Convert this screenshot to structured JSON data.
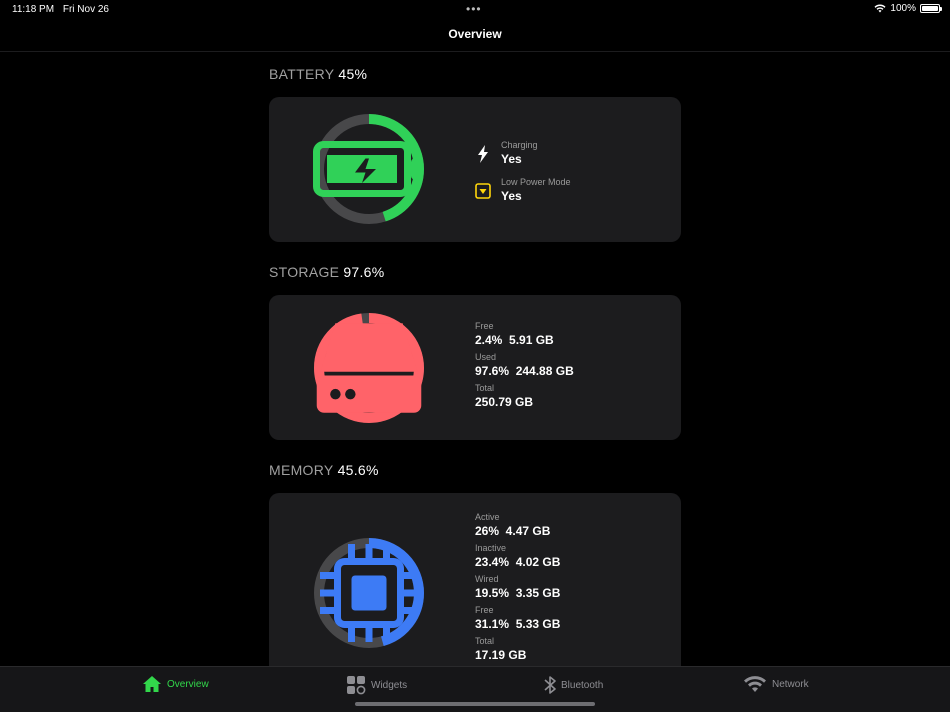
{
  "status": {
    "time": "11:18 PM",
    "date": "Fri Nov 26",
    "battery_text": "100%"
  },
  "nav": {
    "title": "Overview"
  },
  "battery": {
    "title": "BATTERY",
    "value": "45%",
    "level": 0.45,
    "charging_label": "Charging",
    "charging_value": "Yes",
    "lpm_label": "Low Power Mode",
    "lpm_value": "Yes",
    "color": "#30d158"
  },
  "storage": {
    "title": "STORAGE",
    "value": "97.6%",
    "level": 0.976,
    "free_label": "Free",
    "free_value": "2.4%  5.91 GB",
    "used_label": "Used",
    "used_value": "97.6%  244.88 GB",
    "total_label": "Total",
    "total_value": "250.79 GB",
    "color": "#ff6369"
  },
  "memory": {
    "title": "MEMORY",
    "value": "45.6%",
    "level": 0.456,
    "active_label": "Active",
    "active_value": "26%  4.47 GB",
    "inactive_label": "Inactive",
    "inactive_value": "23.4%  4.02 GB",
    "wired_label": "Wired",
    "wired_value": "19.5%  3.35 GB",
    "free_label": "Free",
    "free_value": "31.1%  5.33 GB",
    "total_label": "Total",
    "total_value": "17.19 GB",
    "color": "#3d7bf5"
  },
  "tabs": [
    {
      "label": "Overview",
      "icon": "house-icon",
      "active": true
    },
    {
      "label": "Widgets",
      "icon": "widgets-icon",
      "active": false
    },
    {
      "label": "Bluetooth",
      "icon": "bluetooth-icon",
      "active": false
    },
    {
      "label": "Network",
      "icon": "wifi-icon",
      "active": false
    }
  ]
}
